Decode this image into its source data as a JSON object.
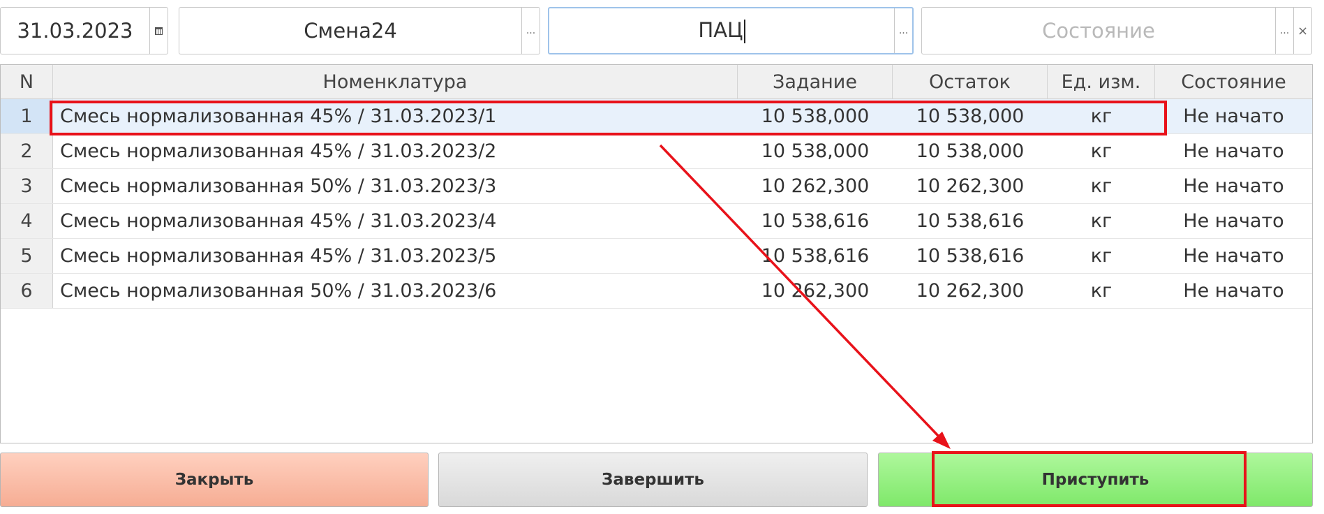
{
  "filters": {
    "date": "31.03.2023",
    "shift": "Смена24",
    "line": "ПАЦ",
    "state_placeholder": "Состояние",
    "ellipsis": "...",
    "clear": "×"
  },
  "table": {
    "headers": {
      "n": "N",
      "nomenclature": "Номенклатура",
      "task": "Задание",
      "rest": "Остаток",
      "unit": "Ед. изм.",
      "state": "Состояние"
    },
    "rows": [
      {
        "n": "1",
        "nomenclature": "Смесь нормализованная 45% / 31.03.2023/1",
        "task": "10 538,000",
        "rest": "10 538,000",
        "unit": "кг",
        "state": "Не начато"
      },
      {
        "n": "2",
        "nomenclature": "Смесь нормализованная 45% / 31.03.2023/2",
        "task": "10 538,000",
        "rest": "10 538,000",
        "unit": "кг",
        "state": "Не начато"
      },
      {
        "n": "3",
        "nomenclature": "Смесь нормализованная 50% / 31.03.2023/3",
        "task": "10 262,300",
        "rest": "10 262,300",
        "unit": "кг",
        "state": "Не начато"
      },
      {
        "n": "4",
        "nomenclature": "Смесь нормализованная 45% / 31.03.2023/4",
        "task": "10 538,616",
        "rest": "10 538,616",
        "unit": "кг",
        "state": "Не начато"
      },
      {
        "n": "5",
        "nomenclature": "Смесь нормализованная 45% / 31.03.2023/5",
        "task": "10 538,616",
        "rest": "10 538,616",
        "unit": "кг",
        "state": "Не начато"
      },
      {
        "n": "6",
        "nomenclature": "Смесь нормализованная 50% / 31.03.2023/6",
        "task": "10 262,300",
        "rest": "10 262,300",
        "unit": "кг",
        "state": "Не начато"
      }
    ]
  },
  "buttons": {
    "close": "Закрыть",
    "finish": "Завершить",
    "start": "Приступить"
  },
  "colors": {
    "annotation": "#e8121a",
    "selected_row": "#e8f1fb",
    "close_button": "#f6ad94",
    "start_button": "#7fe86a"
  }
}
